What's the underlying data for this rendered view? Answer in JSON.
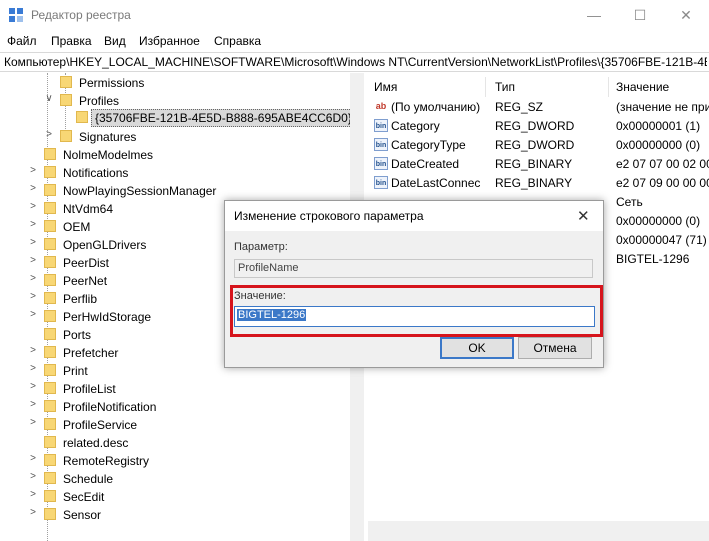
{
  "window": {
    "title": "Редактор реестра",
    "controls": {
      "minimize": "—",
      "maximize": "☐",
      "close": "✕"
    }
  },
  "menu": [
    "Файл",
    "Правка",
    "Вид",
    "Избранное",
    "Справка"
  ],
  "address": "Компьютер\\HKEY_LOCAL_MACHINE\\SOFTWARE\\Microsoft\\Windows NT\\CurrentVersion\\NetworkList\\Profiles\\{35706FBE-121B-4E5",
  "tree": {
    "items": [
      {
        "label": "Permissions",
        "arrow": ""
      },
      {
        "label": "Profiles",
        "arrow": "∨"
      },
      {
        "label": "{35706FBE-121B-4E5D-B888-695ABE4CC6D0}",
        "arrow": ""
      },
      {
        "label": "Signatures",
        "arrow": ">"
      },
      {
        "label": "NolmeModelmes",
        "arrow": ""
      },
      {
        "label": "Notifications",
        "arrow": ">"
      },
      {
        "label": "NowPlayingSessionManager",
        "arrow": ">"
      },
      {
        "label": "NtVdm64",
        "arrow": ">"
      },
      {
        "label": "OEM",
        "arrow": ">"
      },
      {
        "label": "OpenGLDrivers",
        "arrow": ">"
      },
      {
        "label": "PeerDist",
        "arrow": ">"
      },
      {
        "label": "PeerNet",
        "arrow": ">"
      },
      {
        "label": "Perflib",
        "arrow": ">"
      },
      {
        "label": "PerHwIdStorage",
        "arrow": ">"
      },
      {
        "label": "Ports",
        "arrow": ""
      },
      {
        "label": "Prefetcher",
        "arrow": ">"
      },
      {
        "label": "Print",
        "arrow": ">"
      },
      {
        "label": "ProfileList",
        "arrow": ">"
      },
      {
        "label": "ProfileNotification",
        "arrow": ">"
      },
      {
        "label": "ProfileService",
        "arrow": ">"
      },
      {
        "label": "related.desc",
        "arrow": ""
      },
      {
        "label": "RemoteRegistry",
        "arrow": ">"
      },
      {
        "label": "Schedule",
        "arrow": ">"
      },
      {
        "label": "SecEdit",
        "arrow": ">"
      },
      {
        "label": "Sensor",
        "arrow": ">"
      }
    ]
  },
  "list": {
    "columns": [
      "Имя",
      "Тип",
      "Значение"
    ],
    "rows": [
      {
        "icon": "ab",
        "name": "(По умолчанию)",
        "type": "REG_SZ",
        "value": "(значение не при"
      },
      {
        "icon": "bin",
        "name": "Category",
        "type": "REG_DWORD",
        "value": "0x00000001 (1)"
      },
      {
        "icon": "bin",
        "name": "CategoryType",
        "type": "REG_DWORD",
        "value": "0x00000000 (0)"
      },
      {
        "icon": "bin",
        "name": "DateCreated",
        "type": "REG_BINARY",
        "value": "e2 07 07 00 02 00 1"
      },
      {
        "icon": "bin",
        "name": "DateLastConnec",
        "type": "REG_BINARY",
        "value": "e2 07 09 00 00 00 0"
      },
      {
        "icon": "",
        "name": "",
        "type": "",
        "value": "Сеть"
      },
      {
        "icon": "",
        "name": "",
        "type": "",
        "value": "0x00000000 (0)"
      },
      {
        "icon": "",
        "name": "",
        "type": "",
        "value": "0x00000047 (71)"
      },
      {
        "icon": "",
        "name": "",
        "type": "",
        "value": "BIGTEL-1296"
      }
    ]
  },
  "dialog": {
    "title": "Изменение строкового параметра",
    "close": "✕",
    "param_label": "Параметр:",
    "param_value": "ProfileName",
    "value_label": "Значение:",
    "value_text": "BIGTEL-1296",
    "ok_label": "OK",
    "cancel_label": "Отмена"
  },
  "colors": {
    "highlight": "#d6141c",
    "selection": "#3b78c8",
    "folder": "#f8d775"
  }
}
